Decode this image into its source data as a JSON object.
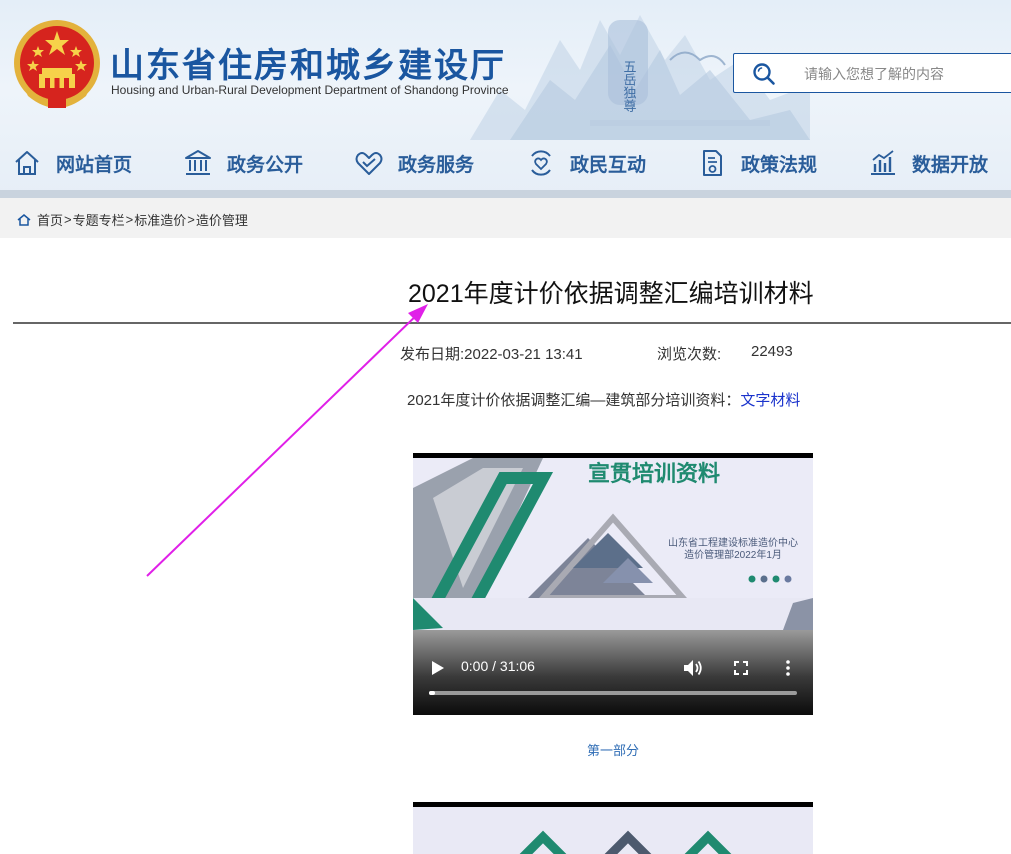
{
  "header": {
    "title": "山东省住房和城乡建设厅",
    "subtitle": "Housing and Urban-Rural Development Department of Shandong Province",
    "mountain_sign": "五岳独尊"
  },
  "search": {
    "placeholder": "请输入您想了解的内容"
  },
  "nav": {
    "items": [
      {
        "label": "网站首页",
        "icon": "home-icon"
      },
      {
        "label": "政务公开",
        "icon": "government-building-icon"
      },
      {
        "label": "政务服务",
        "icon": "handshake-heart-icon"
      },
      {
        "label": "政民互动",
        "icon": "interaction-heart-icon"
      },
      {
        "label": "政策法规",
        "icon": "policy-document-icon"
      },
      {
        "label": "数据开放",
        "icon": "bar-chart-icon"
      }
    ]
  },
  "breadcrumb": {
    "items": [
      "首页",
      "专题专栏",
      "标准造价",
      "造价管理"
    ],
    "separator": ">"
  },
  "article": {
    "title": "2021年度计价依据调整汇编培训材料",
    "publish_label": "发布日期:",
    "publish_date": "2022-03-21 13:41",
    "views_label": "浏览次数:",
    "views": "22493",
    "intro": "2021年度计价依据调整汇编—建筑部分培训资料：",
    "intro_link": "文字材料"
  },
  "videos": [
    {
      "heading": "宣贯培训资料",
      "org_line1": "山东省工程建设标准造价中心",
      "org_line2": "造价管理部2022年1月",
      "time": "0:00 / 31:06",
      "progress": 0.015,
      "caption": "第一部分"
    },
    {
      "heading": "",
      "time": "",
      "caption": ""
    }
  ],
  "colors": {
    "brand_blue": "#1a56a0",
    "nav_text": "#2a5d9a",
    "link": "#1a33cc",
    "caption": "#2f6db5",
    "teal": "#1f8a70",
    "annotation_arrow": "#e020e8"
  }
}
